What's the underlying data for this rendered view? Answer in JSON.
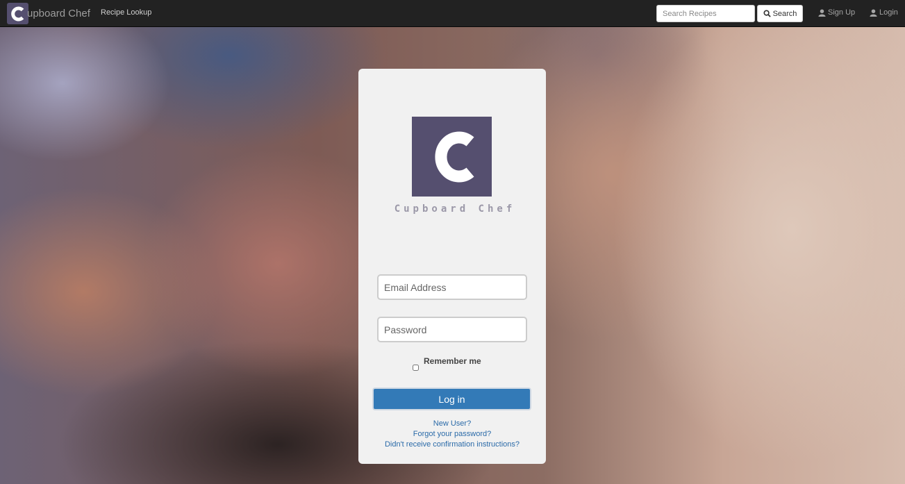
{
  "navbar": {
    "brand_text": "upboard Chef",
    "brand_letter": "C",
    "recipe_lookup": "Recipe Lookup",
    "search_placeholder": "Search Recipes",
    "search_button": "Search",
    "sign_up": "Sign Up",
    "login": "Login"
  },
  "login_card": {
    "logo_letter": "C",
    "logo_caption": "Cupboard Chef",
    "email_placeholder": "Email Address",
    "password_placeholder": "Password",
    "remember_label": "Remember me",
    "login_button": "Log in",
    "links": [
      "New User?",
      "Forgot your password?",
      "Didn't receive confirmation instructions?"
    ]
  },
  "colors": {
    "brand": "#554f6f",
    "primary_button": "#337ab7",
    "navbar_bg": "#222222",
    "link": "#2a6aa8"
  }
}
